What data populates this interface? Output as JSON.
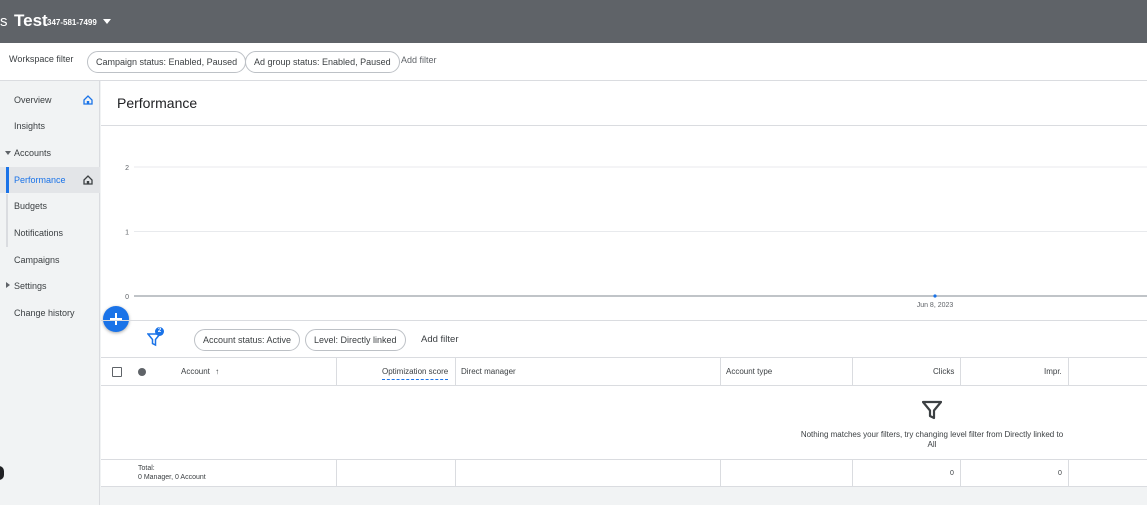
{
  "topbar": {
    "cut_text": "s",
    "title": "Test",
    "account_id": "347-581-7499"
  },
  "filterbar": {
    "workspace_filter": "Workspace filter",
    "chips": [
      "Campaign status: Enabled, Paused",
      "Ad group status: Enabled, Paused"
    ],
    "add_filter": "Add filter"
  },
  "sidebar": {
    "items": [
      {
        "label": "Overview"
      },
      {
        "label": "Insights"
      },
      {
        "label": "Accounts"
      },
      {
        "label": "Performance"
      },
      {
        "label": "Budgets"
      },
      {
        "label": "Notifications"
      },
      {
        "label": "Campaigns"
      },
      {
        "label": "Settings"
      },
      {
        "label": "Change history"
      }
    ]
  },
  "main": {
    "title": "Performance",
    "table_filters": {
      "badge": "2",
      "chips": [
        "Account status: Active",
        "Level: Directly linked"
      ],
      "add_filter": "Add filter"
    },
    "table": {
      "columns": [
        "Account",
        "Optimization score",
        "Direct manager",
        "Account type",
        "Clicks",
        "Impr."
      ],
      "empty_message": "Nothing matches your filters, try changing level filter from Directly linked to All",
      "total_label": "Total:",
      "total_sub": "0 Manager, 0 Account",
      "total_clicks": "0",
      "total_impr": "0"
    }
  },
  "chart_data": {
    "type": "line",
    "x": [
      "Jun 8, 2023"
    ],
    "series": [
      {
        "values": [
          0
        ]
      }
    ],
    "yticks": [
      "2",
      "1",
      "0"
    ],
    "ylim": [
      0,
      2
    ],
    "grid": true,
    "accent": "#1a73e8"
  }
}
